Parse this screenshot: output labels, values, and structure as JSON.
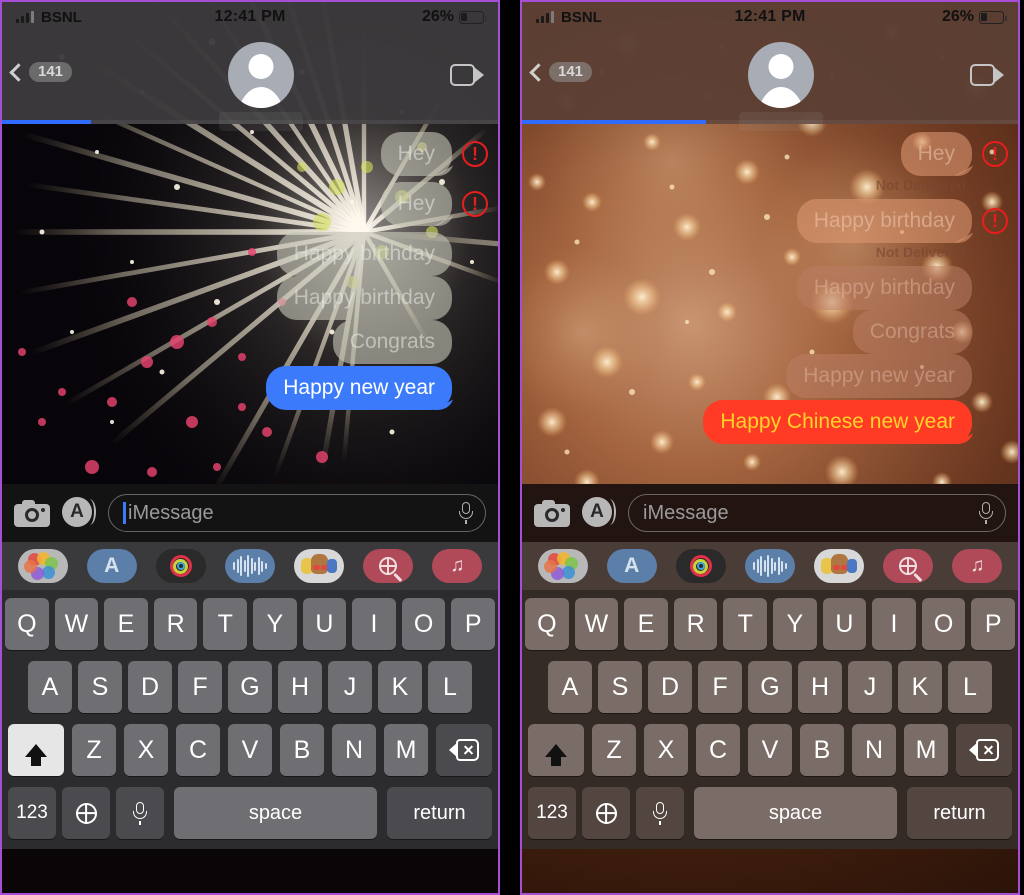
{
  "panels": [
    {
      "id": "left",
      "theme": "fireworks",
      "status_bar": {
        "carrier": "BSNL",
        "time": "12:41 PM",
        "battery_percent": "26%"
      },
      "nav": {
        "back_badge": "141",
        "back_icon": "chevron-left-icon",
        "avatar_icon": "contact-avatar-icon",
        "facetime_icon": "video-camera-icon"
      },
      "progress": {
        "percent": 18
      },
      "background_effect": "fireworks",
      "messages": [
        {
          "text": "Hey",
          "style": "faded-gray",
          "tail": true,
          "error": true,
          "status": ""
        },
        {
          "text": "Hey",
          "style": "faded-gray",
          "tail": true,
          "error": true,
          "status": ""
        },
        {
          "text": "Happy birthday",
          "style": "faded-gray",
          "tail": false,
          "error": false,
          "status": ""
        },
        {
          "text": "Happy birthday",
          "style": "faded-gray",
          "tail": false,
          "error": false,
          "status": ""
        },
        {
          "text": "Congrats",
          "style": "faded-gray",
          "tail": false,
          "error": false,
          "status": ""
        },
        {
          "text": "Happy new year",
          "style": "sent-blue",
          "tail": true,
          "error": false,
          "status": ""
        }
      ],
      "input": {
        "placeholder": "iMessage",
        "value": "",
        "caret": true,
        "camera_icon": "camera-icon",
        "appstore_icon": "app-store-icon",
        "mic_icon": "microphone-icon"
      },
      "app_drawer": [
        "photos-icon",
        "app-store-icon",
        "fitness-icon",
        "voice-memo-icon",
        "memoji-icon",
        "images-search-icon",
        "music-icon"
      ]
    },
    {
      "id": "right",
      "theme": "bokeh",
      "status_bar": {
        "carrier": "BSNL",
        "time": "12:41 PM",
        "battery_percent": "26%"
      },
      "nav": {
        "back_badge": "141",
        "back_icon": "chevron-left-icon",
        "avatar_icon": "contact-avatar-icon",
        "facetime_icon": "video-camera-icon"
      },
      "progress": {
        "percent": 37
      },
      "background_effect": "bokeh",
      "messages": [
        {
          "text": "Hey",
          "style": "faded-warm",
          "tail": true,
          "error": true,
          "status": "Not Delivered"
        },
        {
          "text": "Happy birthday",
          "style": "faded-warm",
          "tail": true,
          "error": true,
          "status": "Not Delivered"
        },
        {
          "text": "Happy birthday",
          "style": "faded-warm2",
          "tail": false,
          "error": false,
          "status": ""
        },
        {
          "text": "Congrats",
          "style": "faded-warm2",
          "tail": false,
          "error": false,
          "status": ""
        },
        {
          "text": "Happy new year",
          "style": "faded-warm2",
          "tail": false,
          "error": false,
          "status": ""
        },
        {
          "text": "Happy Chinese new year",
          "style": "sent-red",
          "tail": true,
          "error": false,
          "status": ""
        }
      ],
      "input": {
        "placeholder": "iMessage",
        "value": "",
        "caret": false,
        "camera_icon": "camera-icon",
        "appstore_icon": "app-store-icon",
        "mic_icon": "microphone-icon"
      },
      "app_drawer": [
        "photos-icon",
        "app-store-icon",
        "fitness-icon",
        "voice-memo-icon",
        "memoji-icon",
        "images-search-icon",
        "music-icon"
      ]
    }
  ],
  "keyboard": {
    "row1": [
      "Q",
      "W",
      "E",
      "R",
      "T",
      "Y",
      "U",
      "I",
      "O",
      "P"
    ],
    "row2": [
      "A",
      "S",
      "D",
      "F",
      "G",
      "H",
      "J",
      "K",
      "L"
    ],
    "row3": [
      "Z",
      "X",
      "C",
      "V",
      "B",
      "N",
      "M"
    ],
    "shift_label": "shift-icon",
    "backspace_label": "backspace-icon",
    "numbers_label": "123",
    "globe_label": "globe-icon",
    "dictation_label": "microphone-icon",
    "space_label": "space",
    "return_label": "return"
  },
  "colors": {
    "imessage_blue": "#3b7bfb",
    "sent_red": "#ff3b25",
    "sent_red_text": "#ffd42a",
    "error_red": "#e81d1d",
    "progress_blue": "#2f6bff",
    "panel_border": "#a64fd6"
  }
}
